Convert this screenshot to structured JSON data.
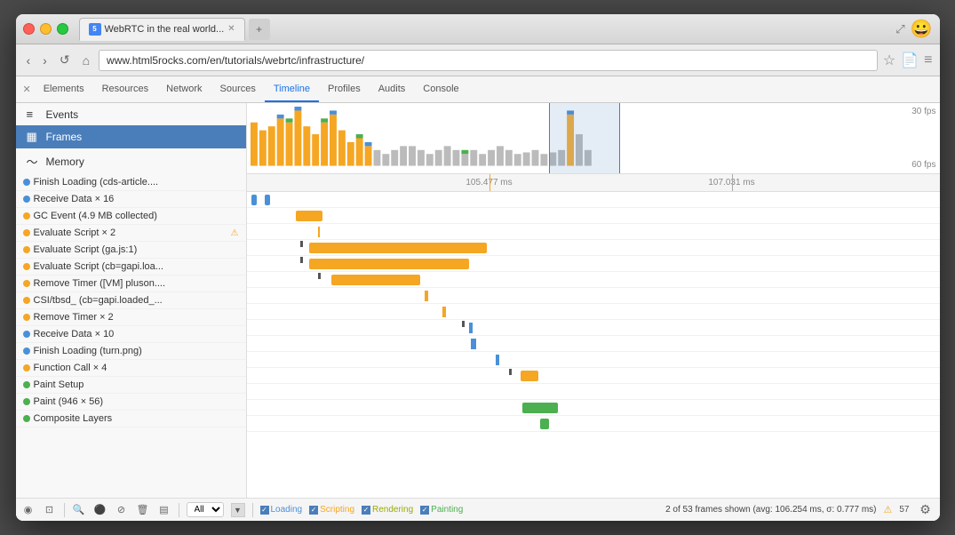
{
  "window": {
    "title": "WebRTC in the real world...",
    "url": "www.html5rocks.com/en/tutorials/webrtc/infrastructure/"
  },
  "devtools_tabs": [
    {
      "label": "Elements",
      "active": false
    },
    {
      "label": "Resources",
      "active": false
    },
    {
      "label": "Network",
      "active": false
    },
    {
      "label": "Sources",
      "active": false
    },
    {
      "label": "Timeline",
      "active": true
    },
    {
      "label": "Profiles",
      "active": false
    },
    {
      "label": "Audits",
      "active": false
    },
    {
      "label": "Console",
      "active": false
    }
  ],
  "sidebar_items": [
    {
      "label": "Events",
      "icon": "≡",
      "active": false
    },
    {
      "label": "Frames",
      "icon": "▦",
      "active": true
    },
    {
      "label": "Memory",
      "icon": "〜",
      "active": false
    }
  ],
  "events": [
    {
      "label": "Finish Loading (cds-article....",
      "color": "#4a90d9",
      "warning": false
    },
    {
      "label": "Receive Data × 16",
      "color": "#4a90d9",
      "warning": false
    },
    {
      "label": "GC Event (4.9 MB collected)",
      "color": "#f5a623",
      "warning": false
    },
    {
      "label": "Evaluate Script × 2",
      "color": "#f5a623",
      "warning": true
    },
    {
      "label": "Evaluate Script (ga.js:1)",
      "color": "#f5a623",
      "warning": false
    },
    {
      "label": "Evaluate Script (cb=gapi.loa...",
      "color": "#f5a623",
      "warning": false
    },
    {
      "label": "Remove Timer ([VM] pluson....",
      "color": "#f5a623",
      "warning": false
    },
    {
      "label": "CSI/tbsd_ (cb=gapi.loaded_...",
      "color": "#f5a623",
      "warning": false
    },
    {
      "label": "Remove Timer × 2",
      "color": "#f5a623",
      "warning": false
    },
    {
      "label": "Receive Data × 10",
      "color": "#4a90d9",
      "warning": false
    },
    {
      "label": "Finish Loading (turn.png)",
      "color": "#4a90d9",
      "warning": false
    },
    {
      "label": "Function Call × 4",
      "color": "#f5a623",
      "warning": false
    },
    {
      "label": "Paint Setup",
      "color": "#4caf50",
      "warning": false
    },
    {
      "label": "Paint (946 × 56)",
      "color": "#4caf50",
      "warning": false
    },
    {
      "label": "Composite Layers",
      "color": "#4caf50",
      "warning": false
    }
  ],
  "ruler_marks": [
    {
      "label": "105.477 ms",
      "percent": 35
    },
    {
      "label": "107.031 ms",
      "percent": 70
    }
  ],
  "status": {
    "filter_all": "All",
    "checkboxes": [
      {
        "label": "Loading",
        "checked": true,
        "color": "#4a90d9"
      },
      {
        "label": "Scripting",
        "checked": true,
        "color": "#f5a623"
      },
      {
        "label": "Rendering",
        "checked": true,
        "color": "#b8b800"
      },
      {
        "label": "Painting",
        "checked": true,
        "color": "#4caf50"
      }
    ],
    "summary": "2 of 53 frames shown (avg: 106.254 ms, σ: 0.777 ms)",
    "warning": "⚠",
    "frame_count": "57"
  },
  "fps_labels": {
    "top": "30 fps",
    "bottom": "60 fps"
  }
}
